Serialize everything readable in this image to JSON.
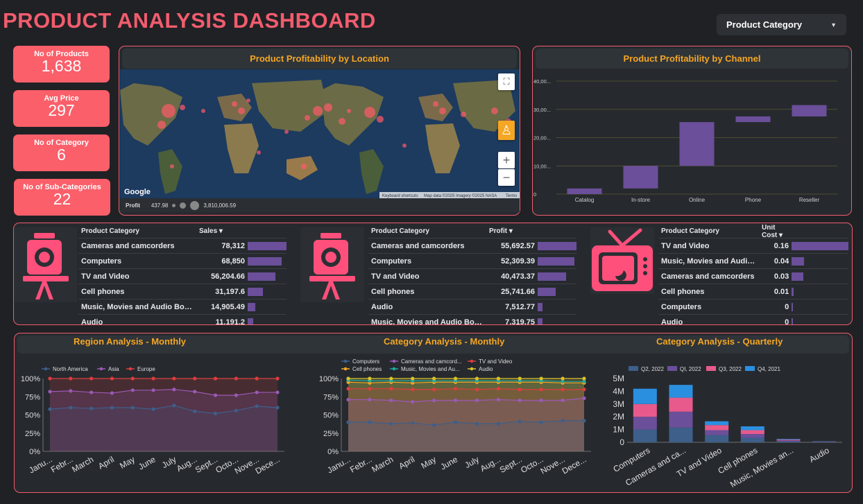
{
  "header": {
    "title": "PRODUCT ANALYSIS DASHBOARD",
    "filter_label": "Product Category"
  },
  "kpis": [
    {
      "label": "No of Products",
      "value": "1,638"
    },
    {
      "label": "Avg Price",
      "value": "297"
    },
    {
      "label": "No of Category",
      "value": "6"
    },
    {
      "label": "No of Sub-Categories",
      "value": "22"
    }
  ],
  "map_panel": {
    "title": "Product Profitability by Location",
    "legend_label": "Profit",
    "legend_min": "437.98",
    "legend_max": "3,810,006.59",
    "google_label": "Google",
    "attribution": [
      "Keyboard shortcuts",
      "Map data ©2025 Imagery ©2025 NASA",
      "Terms"
    ],
    "zoom_in": "+",
    "zoom_out": "−"
  },
  "channel_panel": {
    "title": "Product Profitability by Channel",
    "colors": {
      "bar": "#6b4f9a",
      "grid": "#5a5a2e"
    }
  },
  "sales_table": {
    "headers": [
      "Product Category",
      "Sales ▾"
    ],
    "rows": [
      {
        "name": "Cameras and camcorders",
        "value": "78,312",
        "pct": 1.0
      },
      {
        "name": "Computers",
        "value": "68,850",
        "pct": 0.88
      },
      {
        "name": "TV and Video",
        "value": "56,204.66",
        "pct": 0.72
      },
      {
        "name": "Cell phones",
        "value": "31,197.6",
        "pct": 0.4
      },
      {
        "name": "Music, Movies and Audio Books",
        "value": "14,905.49",
        "pct": 0.19
      },
      {
        "name": "Audio",
        "value": "11,191.2",
        "pct": 0.14
      }
    ]
  },
  "profit_table": {
    "headers": [
      "Product Category",
      "Profit ▾"
    ],
    "rows": [
      {
        "name": "Cameras and camcorders",
        "value": "55,692.57",
        "pct": 1.0
      },
      {
        "name": "Computers",
        "value": "52,309.39",
        "pct": 0.94
      },
      {
        "name": "TV and Video",
        "value": "40,473.37",
        "pct": 0.73
      },
      {
        "name": "Cell phones",
        "value": "25,741.66",
        "pct": 0.46
      },
      {
        "name": "Audio",
        "value": "7,512.77",
        "pct": 0.13
      },
      {
        "name": "Music, Movies and Audio Books",
        "value": "7,319.75",
        "pct": 0.13
      }
    ]
  },
  "cost_table": {
    "headers": [
      "Product Category",
      "Unit Cost ▾"
    ],
    "rows": [
      {
        "name": "TV and Video",
        "value": "0.16",
        "pct": 1.0
      },
      {
        "name": "Music, Movies and Audio ...",
        "value": "0.04",
        "pct": 0.22
      },
      {
        "name": "Cameras and camcorders",
        "value": "0.03",
        "pct": 0.2
      },
      {
        "name": "Cell phones",
        "value": "0.01",
        "pct": 0.03
      },
      {
        "name": "Computers",
        "value": "0",
        "pct": 0.02
      },
      {
        "name": "Audio",
        "value": "0",
        "pct": 0.02
      }
    ]
  },
  "bottom": {
    "region_title": "Region Analysis - Monthly",
    "cat_monthly_title": "Category Analysis - Monthly",
    "cat_quarterly_title": "Category Analysis - Quarterly"
  },
  "colors": {
    "accent": "#f25c6e",
    "kpi": "#fa5f6a",
    "title_orange": "#f5a623",
    "icon_pink": "#ff4f7b"
  },
  "chart_data": [
    {
      "type": "bar",
      "subtype": "waterfall",
      "categories": [
        "Catalog",
        "In-store",
        "Online",
        "Phone",
        "Reseller"
      ],
      "ranges": [
        [
          0,
          2000
        ],
        [
          2000,
          10000
        ],
        [
          10000,
          25500
        ],
        [
          25500,
          27500
        ],
        [
          27500,
          31500
        ]
      ],
      "ylim": [
        0,
        40000
      ],
      "yticks": [
        "0",
        "10,00...",
        "20,00...",
        "30,00...",
        "40,00..."
      ],
      "grid": true
    },
    {
      "type": "line",
      "categories": [
        "Janu...",
        "Febr...",
        "March",
        "April",
        "May",
        "June",
        "July",
        "Aug...",
        "Sept...",
        "Octo...",
        "Nove...",
        "Dece..."
      ],
      "yticks": [
        "0%",
        "25%",
        "50%",
        "75%",
        "100%"
      ],
      "ylim": [
        0,
        100
      ],
      "series": [
        {
          "name": "North America",
          "color": "#3d5f8a",
          "values": [
            58,
            60,
            59,
            60,
            60,
            58,
            63,
            55,
            52,
            56,
            62,
            60
          ]
        },
        {
          "name": "Asia",
          "color": "#9b59b6",
          "values": [
            82,
            83,
            81,
            80,
            84,
            84,
            85,
            82,
            77,
            77,
            81,
            81
          ]
        },
        {
          "name": "Europe",
          "color": "#e03c3c",
          "values": [
            100,
            100,
            100,
            100,
            100,
            100,
            100,
            100,
            100,
            100,
            100,
            100
          ]
        }
      ],
      "legend": "top"
    },
    {
      "type": "line",
      "categories": [
        "Janu...",
        "Febr...",
        "March",
        "April",
        "May",
        "June",
        "July",
        "Aug...",
        "Sept...",
        "Octo...",
        "Nove...",
        "Dece..."
      ],
      "yticks": [
        "0%",
        "25%",
        "50%",
        "75%",
        "100%"
      ],
      "ylim": [
        0,
        100
      ],
      "series": [
        {
          "name": "Computers",
          "color": "#3d5f8a",
          "values": [
            40,
            40,
            38,
            39,
            36,
            40,
            38,
            38,
            41,
            40,
            42,
            42
          ]
        },
        {
          "name": "Cameras and camcord...",
          "color": "#9b59b6",
          "values": [
            71,
            71,
            70,
            68,
            70,
            70,
            70,
            71,
            70,
            70,
            70,
            73
          ]
        },
        {
          "name": "TV and Video",
          "color": "#e03c3c",
          "values": [
            86,
            86,
            86,
            85,
            85,
            86,
            85,
            86,
            85,
            85,
            85,
            85
          ]
        },
        {
          "name": "Cell phones",
          "color": "#f5a623",
          "values": [
            95,
            94,
            95,
            94,
            95,
            95,
            95,
            95,
            95,
            95,
            94,
            94
          ]
        },
        {
          "name": "Music, Movies and Au...",
          "color": "#1fa9a0",
          "values": [
            98,
            97,
            97,
            97,
            97,
            97,
            97,
            97,
            97,
            97,
            96,
            96
          ]
        },
        {
          "name": "Audio",
          "color": "#d9c22c",
          "values": [
            100,
            100,
            100,
            100,
            100,
            100,
            100,
            100,
            100,
            100,
            100,
            100
          ]
        }
      ],
      "legend": "top"
    },
    {
      "type": "bar",
      "subtype": "stacked",
      "categories": [
        "Computers",
        "Cameras and ca...",
        "TV and Video",
        "Cell phones",
        "Music, Movies an...",
        "Audio"
      ],
      "yticks": [
        "0",
        "1M",
        "2M",
        "3M",
        "4M",
        "5M"
      ],
      "ylim": [
        0,
        5000000
      ],
      "series": [
        {
          "name": "Q2, 2022",
          "color": "#3d5f8a",
          "values": [
            1000000,
            1150000,
            550000,
            350000,
            80000,
            30000
          ]
        },
        {
          "name": "QI, 2022",
          "color": "#6b4f9a",
          "values": [
            1000000,
            1250000,
            400000,
            300000,
            70000,
            20000
          ]
        },
        {
          "name": "Q3, 2022",
          "color": "#e75a8b",
          "values": [
            1000000,
            1100000,
            400000,
            300000,
            60000,
            15000
          ]
        },
        {
          "name": "Q4, 2021",
          "color": "#2b8fe0",
          "values": [
            1200000,
            1000000,
            300000,
            300000,
            50000,
            15000
          ]
        }
      ],
      "legend": "top"
    }
  ]
}
